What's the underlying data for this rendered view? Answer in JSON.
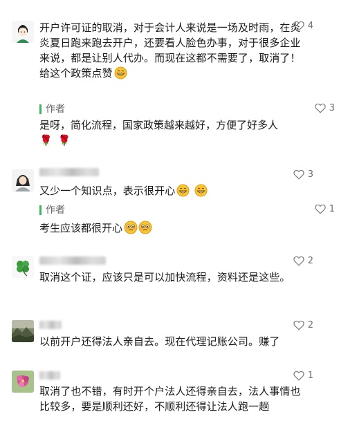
{
  "comments": [
    {
      "likes": "4",
      "text": "开户许可证的取消，对于会计人来说是一场及时雨，在炎炎夏日跑来跑去开户，还要看人脸色办事，对于很多企业来说，都是让别人代办。而现在这都不需要了，取消了！给这个政策点赞",
      "emoji": "grin",
      "reply": {
        "author": "作者",
        "likes": "3",
        "text": "是呀，简化流程，国家政策越来越好，方便了好多人",
        "suffix_icons": [
          "rose-icon",
          "rose-icon"
        ]
      }
    },
    {
      "likes": "3",
      "text": "又少一个知识点，表示很开心",
      "emoji": "grin-grin",
      "reply": {
        "author": "作者",
        "likes": "1",
        "text": "考生应该都很开心",
        "suffix_icons": [
          "awkward-smile-icon",
          "awkward-smile-icon"
        ]
      }
    },
    {
      "likes": "2",
      "text": "取消这个证，应该只是可以加快流程，资料还是这些。"
    },
    {
      "likes": "2",
      "text": "以前开户还得法人亲自去。现在代理记账公司。赚了"
    },
    {
      "likes": "1",
      "text": "取消了也不错，有时开个户法人还得亲自去，法人事情也比较多，要是顺利还好，不顺利还得让法人跑一趟"
    }
  ],
  "colors": {
    "author_bar": "#3db65a",
    "text": "#1a1a1a",
    "muted": "#6b6b6b"
  }
}
